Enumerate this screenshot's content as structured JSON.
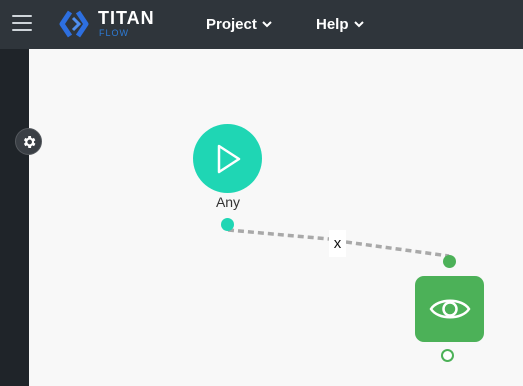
{
  "header": {
    "brand_name": "TITAN",
    "brand_sub": "FLOW",
    "menu": [
      {
        "label": "Project"
      },
      {
        "label": "Help"
      }
    ]
  },
  "icons": {
    "menu": "hamburger-menu-icon",
    "logo": "titan-logo-icon",
    "settings": "gear-icon",
    "start": "play-icon",
    "view": "eye-icon",
    "dropdown": "chevron-down-icon"
  },
  "flow": {
    "start_node": {
      "label": "Any"
    },
    "edge": {
      "delete_label": "x"
    }
  },
  "colors": {
    "topbar": "#2f353b",
    "sidebar": "#1f2429",
    "canvas": "#f8f8f8",
    "start_node": "#1fd6b4",
    "view_node": "#4cb158",
    "brand_accent": "#2d7bd6",
    "edge": "#a9a9a9"
  }
}
